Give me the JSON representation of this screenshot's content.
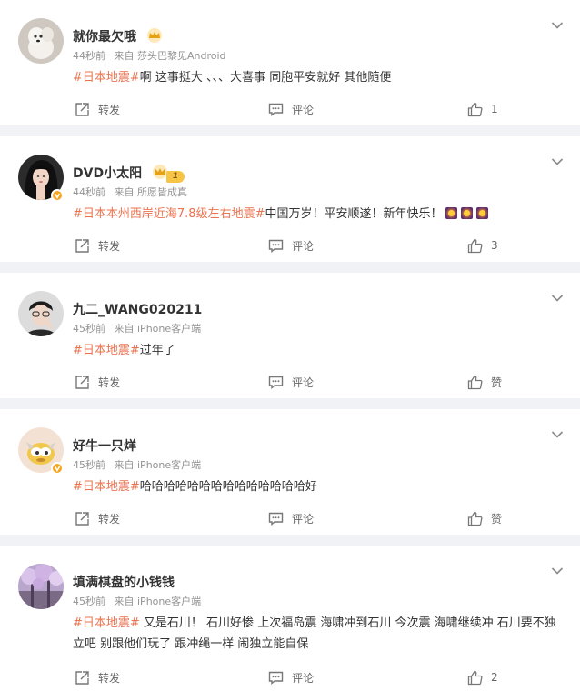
{
  "labels": {
    "repost": "转发",
    "comment": "评论",
    "from": "来自"
  },
  "posts": [
    {
      "user": "就你最欠哦",
      "time": "44秒前",
      "source": "莎头巴黎见Android",
      "topic": "#日本地震#",
      "text": "啊 这事挺大 、、、大喜事 同胞平安就好 其他随便",
      "likes": "1"
    },
    {
      "user": "DVD小太阳",
      "level": "1",
      "time": "44秒前",
      "source": "所愿皆成真",
      "topic": "#日本本州西岸近海7.8级左右地震#",
      "text": "中国万岁！平安顺遂！新年快乐！",
      "likes": "3"
    },
    {
      "user": "九二_WANG020211",
      "time": "45秒前",
      "source": "iPhone客户端",
      "topic": "#日本地震#",
      "text": "过年了",
      "likes": "赞"
    },
    {
      "user": "好牛一只烊",
      "time": "45秒前",
      "source": "iPhone客户端",
      "topic": "#日本地震#",
      "text": "哈哈哈哈哈哈哈哈哈哈哈哈哈哈好",
      "likes": "赞"
    },
    {
      "user": "填满棋盘的小钱钱",
      "time": "45秒前",
      "source": "iPhone客户端",
      "topic": "#日本地震#",
      "text": " 又是石川！ 石川好惨 上次福岛震 海啸冲到石川 今次震 海啸继续冲 石川要不独立吧 别跟他们玩了 跟冲绳一样 闹独立能自保",
      "likes": "2"
    }
  ],
  "colors": {
    "topic": "#eb7350",
    "meta": "#939393",
    "background": "#f1f2f5"
  }
}
